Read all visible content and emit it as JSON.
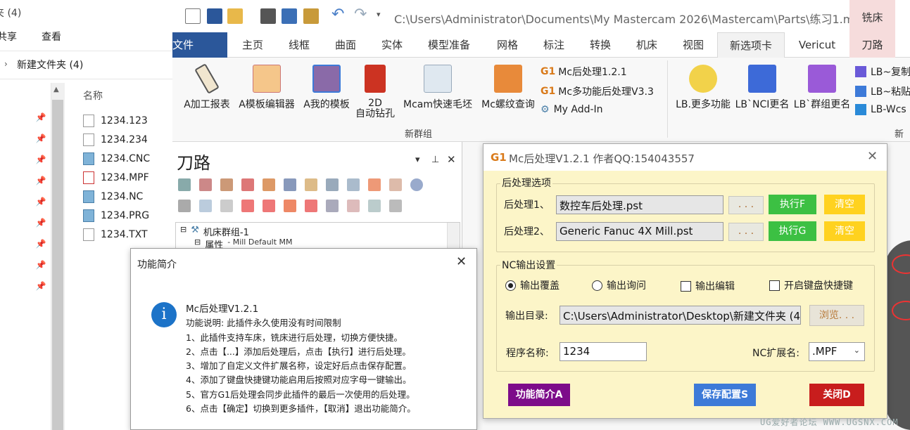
{
  "explorer": {
    "title": "夹 (4)",
    "menu": {
      "share": "共享",
      "view": "查看"
    },
    "folder": "新建文件夹 (4)",
    "column_name": "名称",
    "files": [
      "1234.123",
      "1234.234",
      "1234.CNC",
      "1234.MPF",
      "1234.NC",
      "1234.PRG",
      "1234.TXT"
    ]
  },
  "mastercam": {
    "path": "C:\\Users\\Administrator\\Documents\\My Mastercam 2026\\Mastercam\\Parts\\练习1.mcam...",
    "context_tab": "铣床",
    "tabs": [
      "文件",
      "主页",
      "线框",
      "曲面",
      "实体",
      "模型准备",
      "网格",
      "标注",
      "转换",
      "机床",
      "视图",
      "新选项卡",
      "Vericut",
      "刀路"
    ],
    "ribbon": {
      "buttons": [
        "A加工报表",
        "A模板编辑器",
        "A我的模板",
        "2D",
        "自动钻孔",
        "Mcam快速毛坯",
        "Mc螺纹查询"
      ],
      "g1_label": "G1",
      "lines": [
        "Mc后处理1.2.1",
        "Mc多功能后处理V3.3",
        "My Add-In"
      ],
      "group_label": "新群组",
      "buttons2": [
        "LB.更多功能",
        "LB`NCI更名",
        "LB`群组更名"
      ],
      "lines2": [
        "LB~复制",
        "LB~粘贴",
        "LB-Wcs"
      ],
      "group_label2": "新群"
    },
    "toolpath_panel": {
      "title": "刀路",
      "tree": [
        {
          "label": "机床群组-1",
          "extra": ""
        },
        {
          "label": "属性",
          "extra": " - Mill Default MM"
        }
      ]
    }
  },
  "info_dialog": {
    "title": "功能简介",
    "heading": "Mc后处理V1.2.1",
    "lines": [
      "功能说明:     此插件永久使用没有时间限制",
      "1、此插件支持车床，铣床进行后处理，切换方便快捷。",
      "2、点击【...】添加后处理后，点击【执行】进行后处理。",
      "3、增加了自定义文件扩展名称，设定好后点击保存配置。",
      "4、添加了键盘快捷键功能启用后按照对应字母一键输出。",
      "5、官方G1后处理会同步此插件的最后一次使用的后处理。",
      "6、点击【确定】切换到更多插件，【取消】退出功能简介。"
    ]
  },
  "post_dialog": {
    "g1": "G1",
    "title": "Mc后处理V1.2.1   作者QQ:154043557",
    "group1": "后处理选项",
    "post1_label": "后处理1、",
    "post1_value": "数控车后处理.pst",
    "post2_label": "后处理2、",
    "post2_value": "Generic Fanuc 4X Mill.pst",
    "dots": ". . .",
    "exec1": "执行F",
    "exec2": "执行G",
    "clear": "清空",
    "group2": "NC输出设置",
    "options": [
      "输出覆盖",
      "输出询问",
      "输出编辑",
      "开启键盘快捷键"
    ],
    "outdir_label": "输出目录:",
    "outdir_value": "C:\\Users\\Administrator\\Desktop\\新建文件夹 (4)",
    "browse": "浏览. . .",
    "prog_label": "程序名称:",
    "prog_value": "1234",
    "ext_label": "NC扩展名:",
    "ext_value": ".MPF",
    "btn_info": "功能简介A",
    "btn_save": "保存配置S",
    "btn_close": "关闭D",
    "colors": {
      "info": "#7d0c8a",
      "save": "#3d7ad8",
      "close": "#c81d1d",
      "exec": "#3cc043",
      "clear": "#ffd21f"
    }
  },
  "watermark": "UG爱好者论坛 WWW.UGSNX.COM"
}
